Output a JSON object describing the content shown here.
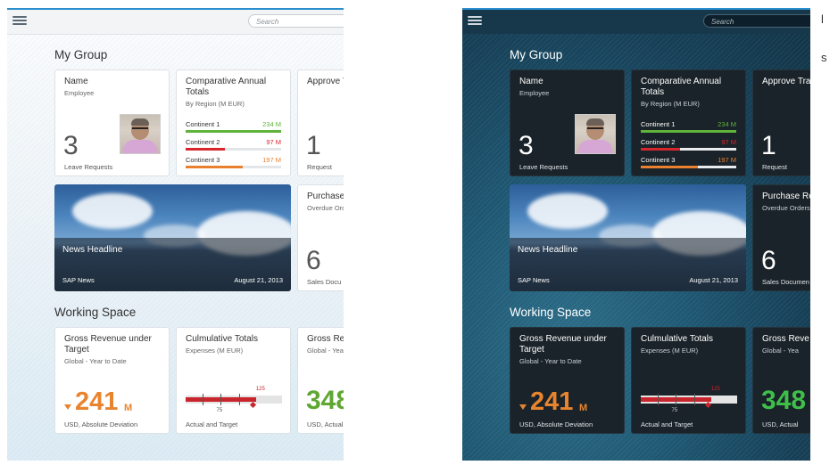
{
  "themes": [
    {
      "id": "light"
    },
    {
      "id": "dark"
    }
  ],
  "search": {
    "placeholder": "Search"
  },
  "sections": {
    "my_group": "My Group",
    "working_space": "Working Space"
  },
  "employee_tile": {
    "title": "Name",
    "subtitle": "Employee",
    "count": "3",
    "footer": "Leave Requests"
  },
  "comparative_tile": {
    "title": "Comparative Annual Totals",
    "subtitle": "By Region (M EUR)",
    "rows": [
      {
        "label": "Continent 1",
        "value": "234 M",
        "color": "#5fb33a",
        "fraction": 1.0
      },
      {
        "label": "Continent 2",
        "value": "97 M",
        "color": "#d8262d",
        "fraction": 0.41
      },
      {
        "label": "Continent 3",
        "value": "197 M",
        "color": "#e98030",
        "fraction": 0.6
      }
    ]
  },
  "approve_tile": {
    "title": "Approve Travel Requests",
    "title_light": "Approve T",
    "title_dark": "Approve Tra",
    "count": "1",
    "footer": "Request"
  },
  "news_tile": {
    "headline": "News Headline",
    "source": "SAP News",
    "date": "August 21, 2013"
  },
  "purchase_tile": {
    "title_light": "Purchase",
    "title_dark": "Purchase Re",
    "subtitle_light": "Overdue Ord",
    "subtitle_dark": "Overdue Orders",
    "count": "6",
    "footer_light": "Sales Docu",
    "footer_dark": "Sales Documen"
  },
  "gross_tile": {
    "title": "Gross Revenue under Target",
    "subtitle": "Global - Year to Date",
    "value": "241",
    "unit": "M",
    "footer": "USD, Absolute Deviation",
    "accent": "#e9842e"
  },
  "cumulative_tile": {
    "title": "Culmulative Totals",
    "subtitle": "Expenses (M EUR)",
    "actual": 110,
    "target": 125,
    "marker": 75,
    "scale_max": 150,
    "label_target": "125",
    "label_marker": "75",
    "footer": "Actual and Target"
  },
  "gross2_tile": {
    "title_light": "Gross Re",
    "title_dark": "Gross Reve",
    "subtitle_light": "Global - Yea",
    "subtitle_dark": "Global - Yea",
    "value": "348",
    "footer_light": "USD, Actual",
    "footer_dark": "USD, Actual"
  },
  "side_letters": [
    "l",
    "s"
  ]
}
